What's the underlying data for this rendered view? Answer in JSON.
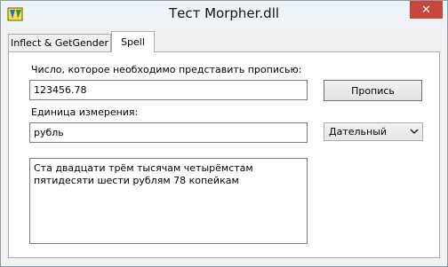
{
  "window": {
    "title": "Тест Morpher.dll",
    "close_glyph": "✕"
  },
  "tabs": [
    {
      "label": "Inflect & GetGender",
      "active": false
    },
    {
      "label": "Spell",
      "active": true
    }
  ],
  "form": {
    "number_label": "Число, которое необходимо представить прописью:",
    "number_value": "123456.78",
    "spell_button": "Пропись",
    "unit_label": "Единица измерения:",
    "unit_value": "рубль",
    "case_select": "Дательный",
    "result_text": "Ста двадцати трём тысячам четырёмстам пятидесяти шести рублям 78 копейкам"
  },
  "icons": {
    "app": "app-logo-icon",
    "close": "close-icon",
    "dropdown": "chevron-down-icon"
  },
  "colors": {
    "close_button": "#c7463d",
    "title_bar": "#eef3f8",
    "window_bg": "#f0f0f0"
  }
}
